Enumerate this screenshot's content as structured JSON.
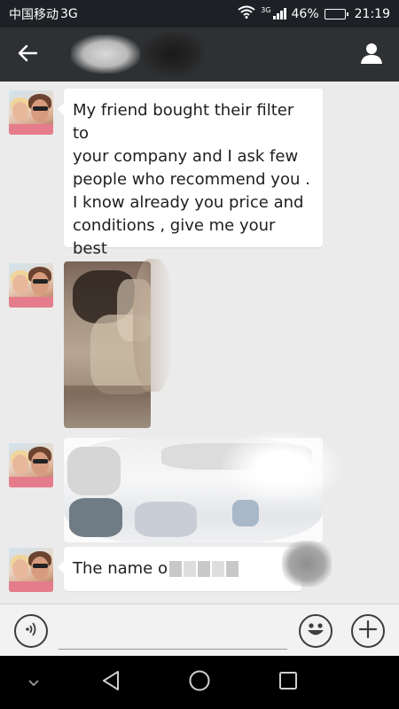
{
  "status_bar": {
    "carrier": "中国移动",
    "network": "3G",
    "signal_tag": "3G",
    "battery": "46%",
    "battery_level": 0.46,
    "time": "21:19"
  },
  "header": {
    "back_icon": "arrow-left-icon",
    "profile_icon": "person-icon"
  },
  "messages": [
    {
      "type": "text",
      "text": "My friend bought their filter to\nyour company and I ask few\npeople who recommend you .\nI know already you price and\nconditions , give me your best\nproposal"
    },
    {
      "type": "image"
    },
    {
      "type": "redacted"
    },
    {
      "type": "text_partial",
      "text": "The name o"
    }
  ],
  "input_bar": {
    "voice_icon": "voice-icon",
    "emoji_icon": "emoji-icon",
    "add_icon": "plus-icon",
    "message_value": ""
  },
  "nav_bar": {
    "icons": [
      "chevron-down-icon",
      "back-triangle-icon",
      "home-circle-icon",
      "recents-square-icon"
    ]
  },
  "colors": {
    "status_bar": "#1d2125",
    "header": "#2e3033",
    "chat_bg": "#ebebeb",
    "bubble": "#ffffff",
    "nav_bar": "#000000"
  }
}
